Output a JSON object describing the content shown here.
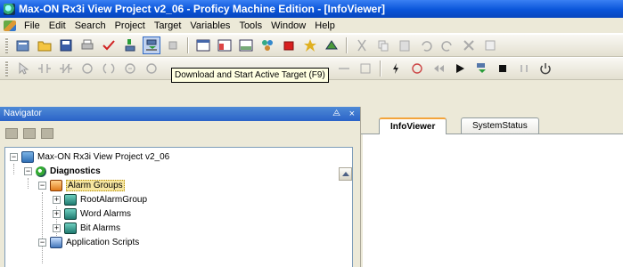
{
  "window": {
    "title": "Max-ON Rx3i View Project v2_06 - Proficy Machine Edition - [InfoViewer]"
  },
  "menu": {
    "items": [
      "File",
      "Edit",
      "Search",
      "Project",
      "Target",
      "Variables",
      "Tools",
      "Window",
      "Help"
    ]
  },
  "toolbar": {
    "tooltip": "Download and Start Active Target (F9)"
  },
  "navigator": {
    "title": "Navigator",
    "pin_glyph": "⨺",
    "close_glyph": "×",
    "tree": {
      "root": "Max-ON Rx3i View Project v2_06",
      "diagnostics": "Diagnostics",
      "alarm_groups": "Alarm Groups",
      "alarm_children": [
        "RootAlarmGroup",
        "Word Alarms",
        "Bit Alarms"
      ],
      "application_scripts": "Application Scripts"
    }
  },
  "tabs": {
    "items": [
      "InfoViewer",
      "SystemStatus"
    ],
    "active": "InfoViewer"
  },
  "colors": {
    "titlebar": "#0a55d9",
    "selection": "#f7e6a0",
    "tab_accent": "#f3a43b"
  }
}
